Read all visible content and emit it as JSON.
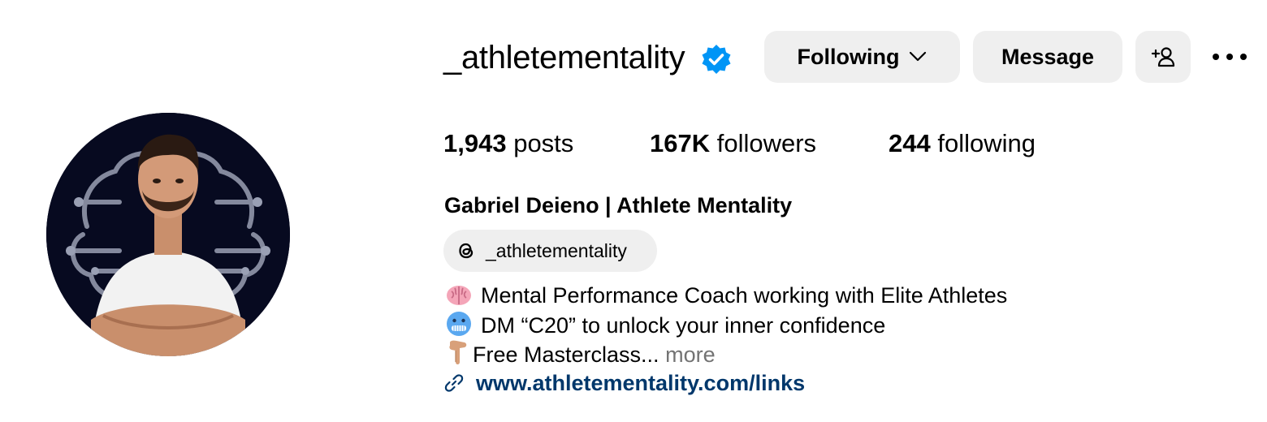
{
  "profile": {
    "username": "_athletementality",
    "verified": true,
    "full_name": "Gabriel Deieno | Athlete Mentality",
    "avatar_icon": "profile-photo"
  },
  "actions": {
    "following_label": "Following",
    "message_label": "Message",
    "add_user_icon": "person-plus-icon",
    "more_icon": "ellipsis-icon"
  },
  "stats": [
    {
      "value": "1,943",
      "label": "posts"
    },
    {
      "value": "167K",
      "label": "followers"
    },
    {
      "value": "244",
      "label": "following"
    }
  ],
  "threads": {
    "icon": "threads-icon",
    "handle": "_athletementality"
  },
  "bio": {
    "line1": {
      "emoji_icon": "brain-emoji",
      "text": "Mental Performance Coach working with Elite Athletes"
    },
    "line2": {
      "emoji_icon": "cold-face-emoji",
      "text": "DM “C20” to unlock your inner confidence"
    },
    "line3": {
      "emoji_icon": "pointing-down-emoji",
      "text": "Free Masterclass...",
      "more_label": "more"
    }
  },
  "link": {
    "icon": "link-icon",
    "url": "www.athletementality.com/links",
    "color": "#00376b"
  },
  "colors": {
    "verified_blue": "#0095f6",
    "button_bg": "#efefef",
    "muted": "#737373"
  }
}
